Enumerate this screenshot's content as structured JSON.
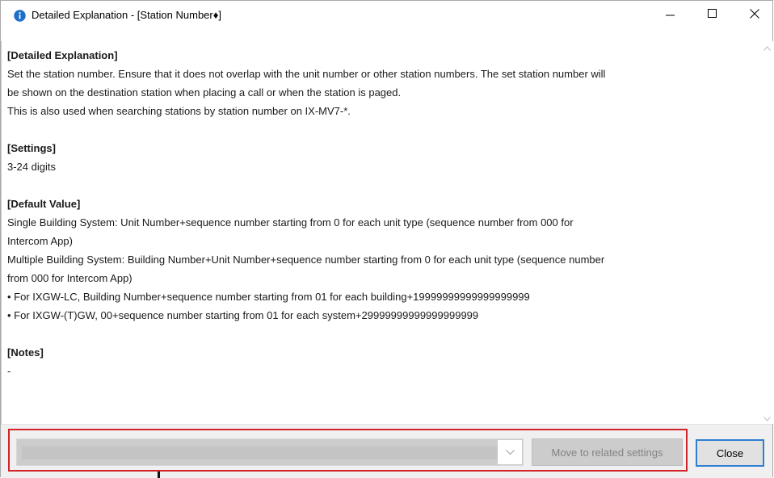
{
  "window": {
    "title": "Detailed Explanation - [Station Number♦]",
    "title_icon": "info-icon",
    "controls": {
      "minimize_icon": "minimize-icon",
      "maximize_icon": "maximize-icon",
      "close_icon": "close-icon"
    }
  },
  "content": {
    "sections": [
      {
        "heading": "[Detailed Explanation]",
        "lines": [
          "Set the station number. Ensure that it does not overlap with the unit number or other station numbers. The set station number will",
          "be shown on the destination station when placing a call or when the station is paged.",
          "This is also used when searching stations by station number on IX-MV7-*."
        ]
      },
      {
        "heading": "[Settings]",
        "lines": [
          "3-24 digits"
        ]
      },
      {
        "heading": "[Default Value]",
        "lines": [
          "Single Building System: Unit Number+sequence number starting from 0 for each unit type (sequence number from 000 for",
          "Intercom App)",
          "Multiple Building System: Building Number+Unit Number+sequence number starting from 0 for each unit type (sequence number",
          "from 000 for Intercom App)",
          "• For IXGW-LC, Building Number+sequence number starting from 01 for each building+19999999999999999999",
          "• For IXGW-(T)GW, 00+sequence number starting from 01 for each system+29999999999999999999"
        ]
      },
      {
        "heading": "[Notes]",
        "lines": [
          "-"
        ]
      }
    ]
  },
  "footer": {
    "related_select_value": "",
    "move_button_label": "Move to related settings",
    "close_button_label": "Close",
    "highlight_color": "#d2232a",
    "focus_color": "#2f7fd2"
  }
}
